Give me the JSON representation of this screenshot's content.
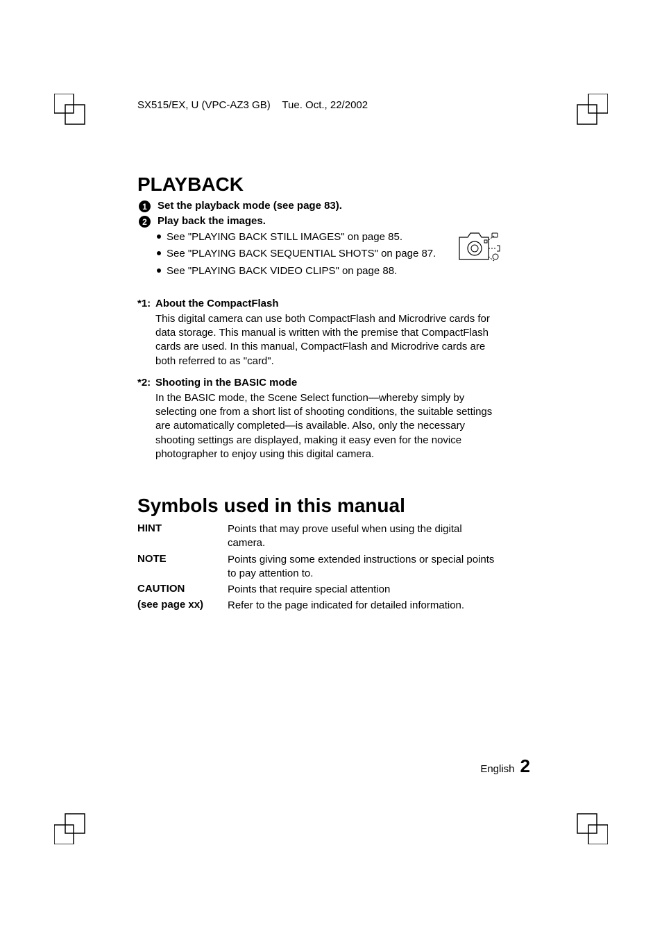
{
  "header": {
    "model_info": "SX515/EX, U (VPC-AZ3 GB)",
    "date": "Tue. Oct., 22/2002"
  },
  "playback": {
    "title": "PLAYBACK",
    "step1": "Set the playback mode (see page 83).",
    "step2": "Play back the images.",
    "bullets": {
      "b1": "See \"PLAYING BACK STILL IMAGES\" on page 85.",
      "b2": "See \"PLAYING BACK SEQUENTIAL SHOTS\" on page 87.",
      "b3": "See \"PLAYING BACK VIDEO CLIPS\" on page 88."
    }
  },
  "asterisks": {
    "a1": {
      "label": "*1:",
      "title": "About the CompactFlash",
      "body": "This digital camera can use both CompactFlash and Microdrive cards for data storage. This manual is written with the premise that CompactFlash cards are used. In this manual, CompactFlash and Microdrive cards are both referred to as \"card\"."
    },
    "a2": {
      "label": "*2:",
      "title": "Shooting in the BASIC mode",
      "body": "In the BASIC mode, the Scene Select function—whereby simply by selecting one from a short list of shooting conditions, the suitable settings are automatically completed—is available. Also, only the necessary shooting settings are displayed, making it easy even for the novice photographer to enjoy using this digital camera."
    }
  },
  "symbols": {
    "title": "Symbols used in this manual",
    "rows": {
      "hint": {
        "label": "HINT",
        "desc": "Points that may prove useful when using the digital camera."
      },
      "note": {
        "label": "NOTE",
        "desc": "Points giving some extended instructions or special points to pay attention to."
      },
      "caution": {
        "label": "CAUTION",
        "desc": "Points that require special attention"
      },
      "seepage": {
        "label": "(see page xx)",
        "desc": "Refer to the page indicated for detailed information."
      }
    }
  },
  "footer": {
    "language": "English",
    "page": "2"
  }
}
